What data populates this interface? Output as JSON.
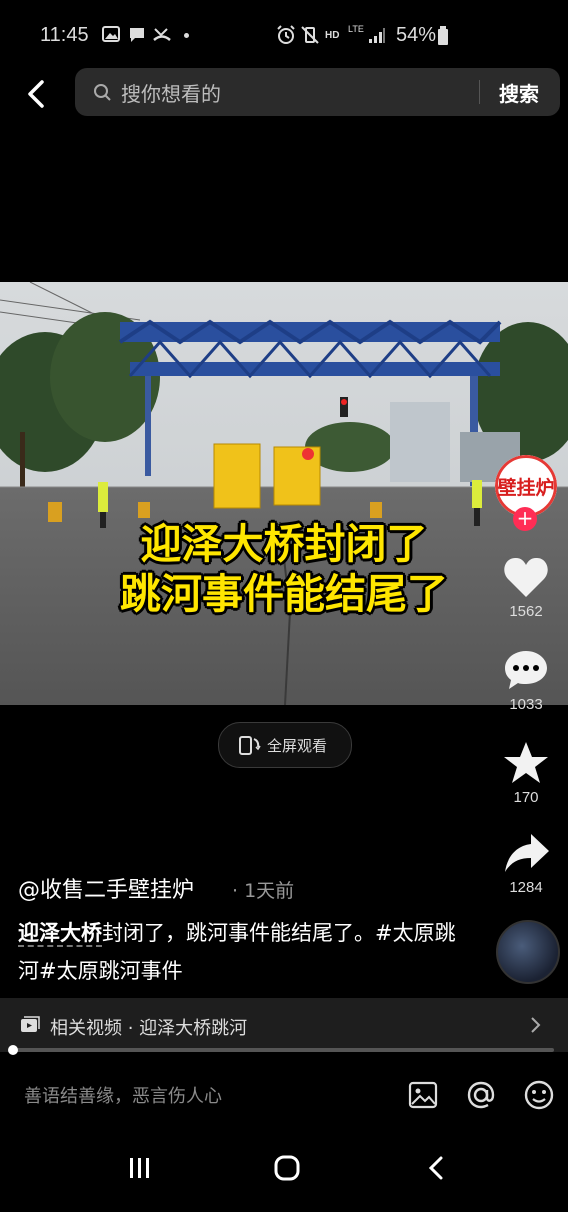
{
  "status_bar": {
    "time": "11:45",
    "hd": "HD",
    "lte": "LTE",
    "battery": "54%"
  },
  "search": {
    "placeholder": "搜你想看的",
    "button": "搜索"
  },
  "video": {
    "caption_line1": "迎泽大桥封闭了",
    "caption_line2": "跳河事件能结尾了",
    "fullscreen_label": "全屏观看"
  },
  "rail": {
    "avatar_text": "壁挂炉",
    "likes": "1562",
    "comments": "1033",
    "favorites": "170",
    "shares": "1284"
  },
  "post": {
    "author": "@收售二手壁挂炉",
    "time_ago": "· 1天前",
    "desc_link": "迎泽大桥",
    "desc_text": "封闭了，跳河事件能结尾了。#太原跳河#太原跳河事件"
  },
  "related": {
    "label": "相关视频 · 迎泽大桥跳河"
  },
  "progress": {
    "fraction": 0.0
  },
  "comment_bar": {
    "placeholder": "善语结善缘，恶言伤人心"
  }
}
